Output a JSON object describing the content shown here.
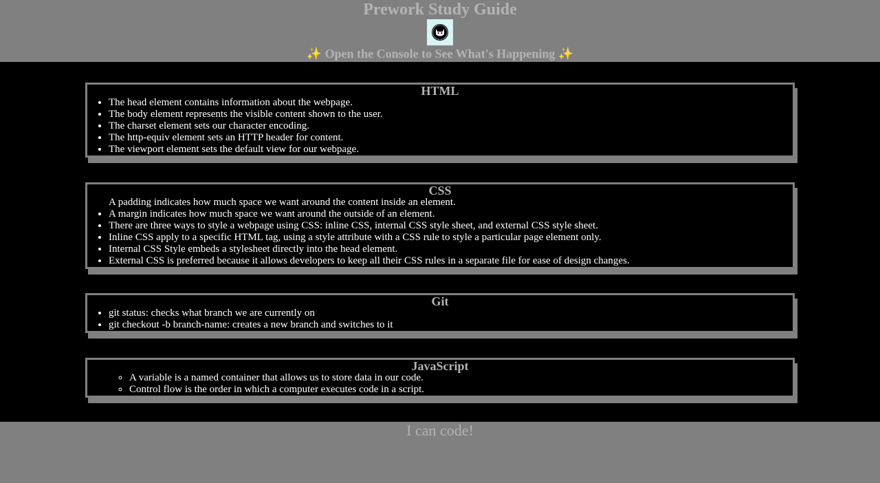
{
  "header": {
    "title": "Prework Study Guide",
    "subtitle": "✨ Open the Console to See What's Happening ✨"
  },
  "sections": [
    {
      "title": "HTML",
      "items": [
        "The head element contains information about the webpage.",
        "The body element represents the visible content shown to the user.",
        "The charset element sets our character encoding.",
        "The http-equiv element sets an HTTP header for content.",
        "The viewport element sets the default view for our webpage."
      ]
    },
    {
      "title": "CSS",
      "items": [
        "A padding indicates how much space we want around the content inside an element.",
        "A margin indicates how much space we want around the outside of an element.",
        "There are three ways to style a webpage using CSS: inline CSS, internal CSS style sheet, and external CSS style sheet.",
        "Inline CSS apply to a specific HTML tag, using a style attribute with a CSS rule to style a particular page element only.",
        "Internal CSS Style embeds a stylesheet directly into the head element.",
        "External CSS is preferred because it allows developers to keep all their CSS rules in a separate file for ease of design changes."
      ]
    },
    {
      "title": "Git",
      "items": [
        "git status: checks what branch we are currently on",
        "git checkout -b branch-name: creates a new branch and switches to it"
      ]
    },
    {
      "title": "JavaScript",
      "items": [
        "A variable is a named container that allows us to store data in our code.",
        "Control flow is the order in which a computer executes code in a script."
      ]
    }
  ],
  "footer": {
    "text": "I can code!"
  },
  "colors": {
    "header_bg": "#808080",
    "heading_text": "#b4b4b4",
    "body_bg": "#000000",
    "list_text": "#ffffff"
  },
  "icons": {
    "avatar": "cat-avatar-icon"
  }
}
